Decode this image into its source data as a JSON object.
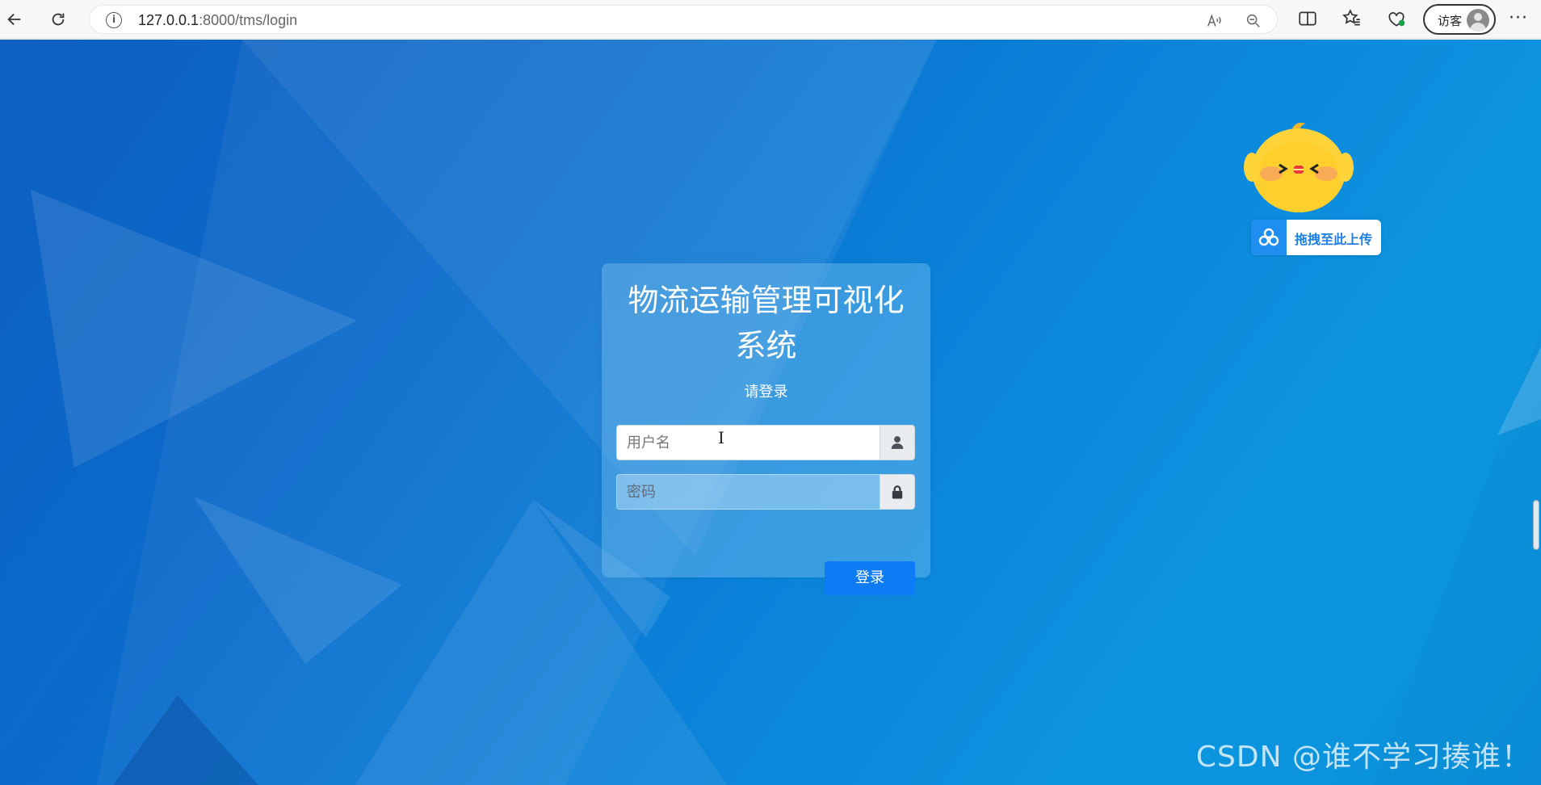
{
  "browser": {
    "url_host": "127.0.0.1",
    "url_path": ":8000/tms/login",
    "profile_label": "访客",
    "more_label": "···"
  },
  "login": {
    "title": "物流运输管理可视化系统",
    "subtitle": "请登录",
    "username_placeholder": "用户名",
    "password_placeholder": "密码",
    "submit_label": "登录"
  },
  "upload_widget": {
    "label": "拖拽至此上传"
  },
  "watermark": "CSDN @谁不学习揍谁！",
  "colors": {
    "background_start": "#0d5fc0",
    "background_end": "#0c96e0",
    "login_button": "#0d7bf4",
    "upload_icon_bg": "#1e8ff0"
  },
  "icons": {
    "back": "back-arrow-icon",
    "reload": "reload-icon",
    "info": "info-icon",
    "read_aloud": "read-aloud-icon",
    "zoom": "zoom-out-icon",
    "split": "split-screen-icon",
    "favorites": "favorites-icon",
    "health": "browser-essentials-icon",
    "user": "user-icon",
    "lock": "lock-icon",
    "cloud": "cloud-upload-icon"
  }
}
